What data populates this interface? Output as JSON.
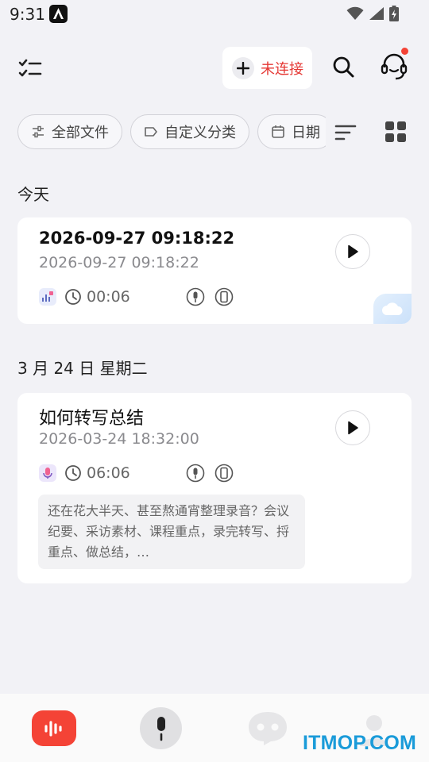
{
  "status_bar": {
    "time": "9:31"
  },
  "header": {
    "connect_label": "未连接"
  },
  "filters": {
    "chips": [
      "全部文件",
      "自定义分类",
      "日期"
    ]
  },
  "sections": [
    {
      "title": "今天"
    },
    {
      "title": "3 月 24 日  星期二"
    }
  ],
  "recordings": [
    {
      "title": "2026-09-27 09:18:22",
      "date": "2026-09-27 09:18:22",
      "duration": "00:06",
      "source": "chart-icon",
      "cloud": true
    },
    {
      "title": "如何转写总结",
      "date": "2026-03-24 18:32:00",
      "duration": "06:06",
      "source": "microphone-icon",
      "summary": "还在花大半天、甚至熬通宵整理录音？会议纪要、采访素材、课程重点，录完转写、捋重点、做总结，…"
    }
  ],
  "colors": {
    "accent": "#f44336",
    "connect_text": "#e53935",
    "watermark": "#1a9bd9",
    "background": "#f2f2f6"
  },
  "watermark": "ITMOP.COM"
}
